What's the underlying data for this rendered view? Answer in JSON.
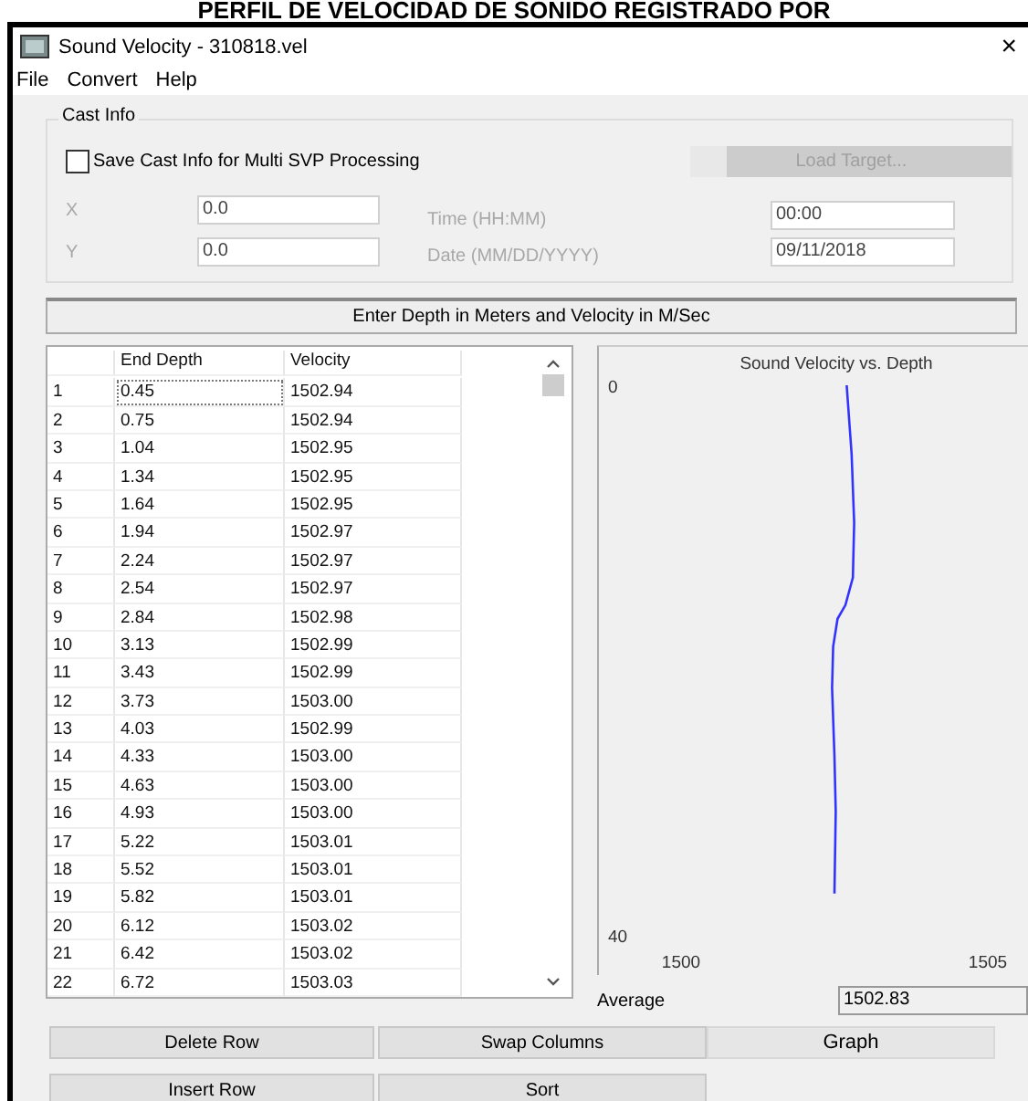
{
  "page_heading": "PERFIL DE VELOCIDAD DE SONIDO REGISTRADO POR",
  "window": {
    "title": "Sound Velocity - 310818.vel",
    "close": "×"
  },
  "menu": [
    "File",
    "Convert",
    "Help"
  ],
  "cast_info": {
    "title": "Cast Info",
    "save_checkbox": {
      "label": "Save Cast Info for Multi SVP Processing",
      "checked": false
    },
    "load_target": {
      "label": "Load Target...",
      "disabled": true
    },
    "x": {
      "label": "X",
      "value": "0.0",
      "disabled": true
    },
    "y": {
      "label": "Y",
      "value": "0.0",
      "disabled": true
    },
    "time": {
      "label": "Time (HH:MM)",
      "value": "00:00",
      "disabled": true
    },
    "date": {
      "label": "Date (MM/DD/YYYY)",
      "value": "09/11/2018",
      "disabled": true
    }
  },
  "instruction": "Enter Depth in Meters and Velocity in M/Sec",
  "table": {
    "columns": [
      "End Depth",
      "Velocity"
    ],
    "rows": [
      {
        "index": "1",
        "depth": "0.45",
        "velocity": "1502.94",
        "focused": true
      },
      {
        "index": "2",
        "depth": "0.75",
        "velocity": "1502.94",
        "focused": false
      },
      {
        "index": "3",
        "depth": "1.04",
        "velocity": "1502.95",
        "focused": false
      },
      {
        "index": "4",
        "depth": "1.34",
        "velocity": "1502.95",
        "focused": false
      },
      {
        "index": "5",
        "depth": "1.64",
        "velocity": "1502.95",
        "focused": false
      },
      {
        "index": "6",
        "depth": "1.94",
        "velocity": "1502.97",
        "focused": false
      },
      {
        "index": "7",
        "depth": "2.24",
        "velocity": "1502.97",
        "focused": false
      },
      {
        "index": "8",
        "depth": "2.54",
        "velocity": "1502.97",
        "focused": false
      },
      {
        "index": "9",
        "depth": "2.84",
        "velocity": "1502.98",
        "focused": false
      },
      {
        "index": "10",
        "depth": "3.13",
        "velocity": "1502.99",
        "focused": false
      },
      {
        "index": "11",
        "depth": "3.43",
        "velocity": "1502.99",
        "focused": false
      },
      {
        "index": "12",
        "depth": "3.73",
        "velocity": "1503.00",
        "focused": false
      },
      {
        "index": "13",
        "depth": "4.03",
        "velocity": "1502.99",
        "focused": false
      },
      {
        "index": "14",
        "depth": "4.33",
        "velocity": "1503.00",
        "focused": false
      },
      {
        "index": "15",
        "depth": "4.63",
        "velocity": "1503.00",
        "focused": false
      },
      {
        "index": "16",
        "depth": "4.93",
        "velocity": "1503.00",
        "focused": false
      },
      {
        "index": "17",
        "depth": "5.22",
        "velocity": "1503.01",
        "focused": false
      },
      {
        "index": "18",
        "depth": "5.52",
        "velocity": "1503.01",
        "focused": false
      },
      {
        "index": "19",
        "depth": "5.82",
        "velocity": "1503.01",
        "focused": false
      },
      {
        "index": "20",
        "depth": "6.12",
        "velocity": "1503.02",
        "focused": false
      },
      {
        "index": "21",
        "depth": "6.42",
        "velocity": "1503.02",
        "focused": false
      },
      {
        "index": "22",
        "depth": "6.72",
        "velocity": "1503.03",
        "focused": false
      }
    ]
  },
  "chart": {
    "chart_data": {
      "type": "line",
      "title": "Sound Velocity vs. Depth",
      "x": [
        1502.7,
        1502.78,
        1502.82,
        1502.8,
        1502.68,
        1502.55,
        1502.48,
        1502.46,
        1502.5,
        1502.52,
        1502.5
      ],
      "series": [
        {
          "color": "#3333ff",
          "values": [
            0,
            5,
            10,
            14,
            16,
            17,
            19,
            22,
            27,
            31,
            37
          ]
        }
      ],
      "xlim": [
        1500,
        1505
      ],
      "ylim": [
        40,
        0
      ],
      "xticks": [
        1500,
        1505
      ],
      "yticks": [
        0,
        40
      ]
    }
  },
  "average": {
    "label": "Average",
    "value": "1502.83"
  },
  "buttons": [
    {
      "label": "Delete Row",
      "kind": "normal"
    },
    {
      "label": "Swap Columns",
      "kind": "normal"
    },
    {
      "label": "Graph",
      "kind": "flat"
    },
    {
      "label": "Insert Row",
      "kind": "normal"
    },
    {
      "label": "Sort",
      "kind": "normal"
    }
  ]
}
